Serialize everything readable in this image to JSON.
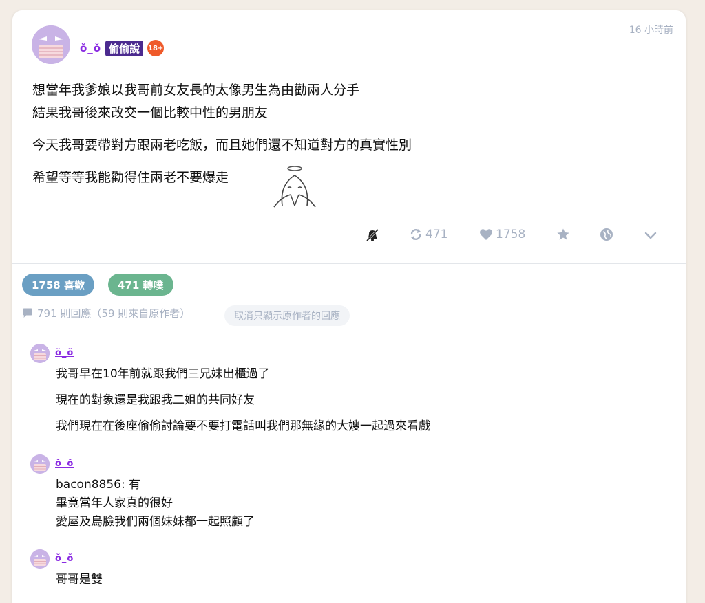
{
  "post": {
    "author": "ŏ_ŏ",
    "board": "偷偷說",
    "age_badge": "18+",
    "time": "16 小時前",
    "paragraphs": [
      "想當年我爹娘以我哥前女友長的太像男生為由勸兩人分手",
      "結果我哥後來改交一個比較中性的男朋友",
      "今天我哥要帶對方跟兩老吃飯，而且她們還不知道對方的真實性別",
      "希望等等我能勸得住兩老不要爆走"
    ],
    "sticker_icon": "praying-angel-sticker"
  },
  "actions": {
    "mute_icon": "mute-icon",
    "repost_count": "471",
    "like_count": "1758",
    "favorite_icon": "star-icon",
    "share_icon": "share-icon",
    "more_icon": "chevron-down-icon"
  },
  "stats": {
    "likes_label": "1758 喜歡",
    "reposts_label": "471 轉噗",
    "replies_label": "791 則回應（59 則來自原作者）",
    "filter_label": "取消只顯示原作者的回應"
  },
  "comments": [
    {
      "author": "ŏ_ŏ",
      "lines": [
        "我哥早在10年前就跟我們三兄妹出櫃過了",
        "現在的對象還是我跟我二姐的共同好友",
        "我們現在在後座偷偷討論要不要打電話叫我們那無緣的大嫂一起過來看戲"
      ]
    },
    {
      "author": "ŏ_ŏ",
      "lines": [
        "bacon8856: 有",
        "畢竟當年人家真的很好",
        "愛屋及烏臉我們兩個妹妹都一起照顧了"
      ]
    },
    {
      "author": "ŏ_ŏ",
      "lines": [
        "哥哥是雙"
      ]
    }
  ],
  "colors": {
    "background": "#f3ede6",
    "author_purple": "#8a2be2",
    "board_tag": "#4b2a8f",
    "age_badge": "#ef5a2a",
    "likes_pill": "#6a9fc3",
    "reposts_pill": "#6bb58f",
    "muted_text": "#a8b2c3"
  }
}
